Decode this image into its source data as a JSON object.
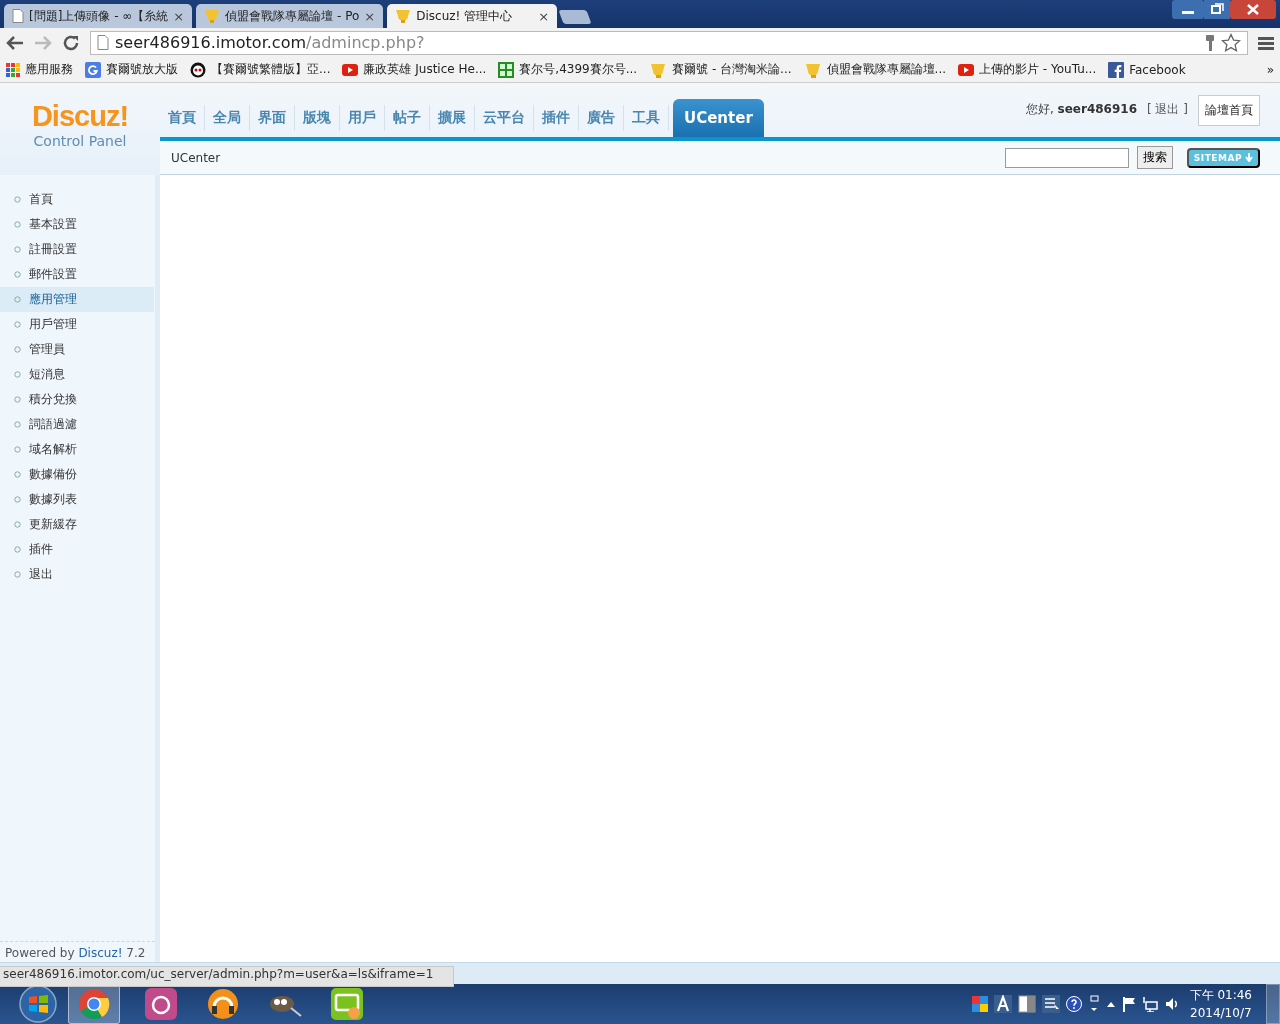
{
  "browser": {
    "tabs": [
      {
        "title": "[問題]上傳頭像 - ∞【糸統",
        "close": "×",
        "selected": false
      },
      {
        "title": "偵盟會戰隊專屬論壇 - Po",
        "close": "×",
        "selected": false
      },
      {
        "title": "Discuz! 管理中心",
        "close": "×",
        "selected": true
      }
    ],
    "address": {
      "host": "seer486916.imotor.com",
      "path": "/admincp.php?"
    },
    "bookmarks": [
      {
        "label": "應用服務",
        "kind": "apps"
      },
      {
        "label": "賽爾號放大版",
        "kind": "google"
      },
      {
        "label": "【賽爾號繁體版】亞...",
        "kind": "panda"
      },
      {
        "label": "廉政英雄 Justice He...",
        "kind": "youtube"
      },
      {
        "label": "賽尔号,4399賽尔号...",
        "kind": "grid"
      },
      {
        "label": "賽爾號 - 台灣淘米論...",
        "kind": "forum"
      },
      {
        "label": "偵盟會戰隊專屬論壇...",
        "kind": "forum"
      },
      {
        "label": "上傳的影片 - YouTu...",
        "kind": "youtube"
      },
      {
        "label": "Facebook",
        "kind": "facebook"
      }
    ],
    "bookmarks_more": "»"
  },
  "admin": {
    "logo": "Discuz!",
    "logo_subtitle": "Control Panel",
    "nav": [
      {
        "label": "首頁",
        "selected": false
      },
      {
        "label": "全局",
        "selected": false
      },
      {
        "label": "界面",
        "selected": false
      },
      {
        "label": "版塊",
        "selected": false
      },
      {
        "label": "用戶",
        "selected": false
      },
      {
        "label": "帖子",
        "selected": false
      },
      {
        "label": "擴展",
        "selected": false
      },
      {
        "label": "云平台",
        "selected": false
      },
      {
        "label": "插件",
        "selected": false
      },
      {
        "label": "廣告",
        "selected": false
      },
      {
        "label": "工具",
        "selected": false
      },
      {
        "label": "UCenter",
        "selected": true
      }
    ],
    "greeting": "您好, **seer486916**",
    "logout": "[ 退出 ]",
    "forum_home_button": "論壇首頁",
    "breadcrumb": "UCenter",
    "search_button": "搜索",
    "sitemap_button": "SITEMAP"
  },
  "sidebar": {
    "items": [
      {
        "label": "首頁",
        "selected": false
      },
      {
        "label": "基本設置",
        "selected": false
      },
      {
        "label": "註冊設置",
        "selected": false
      },
      {
        "label": "郵件設置",
        "selected": false
      },
      {
        "label": "應用管理",
        "selected": true
      },
      {
        "label": "用戶管理",
        "selected": false
      },
      {
        "label": "管理員",
        "selected": false
      },
      {
        "label": "短消息",
        "selected": false
      },
      {
        "label": "積分兌換",
        "selected": false
      },
      {
        "label": "詞語過濾",
        "selected": false
      },
      {
        "label": "域名解析",
        "selected": false
      },
      {
        "label": "數據備份",
        "selected": false
      },
      {
        "label": "數據列表",
        "selected": false
      },
      {
        "label": "更新緩存",
        "selected": false
      },
      {
        "label": "插件",
        "selected": false
      },
      {
        "label": "退出",
        "selected": false
      }
    ],
    "footer": {
      "prefix": "Powered by",
      "link": "Discuz!",
      "version": "7.2"
    }
  },
  "status_url": "seer486916.imotor.com/uc_server/admin.php?m=user&a=ls&iframe=1",
  "taskbar": {
    "time": "下午 01:46",
    "date": "2014/10/7"
  }
}
